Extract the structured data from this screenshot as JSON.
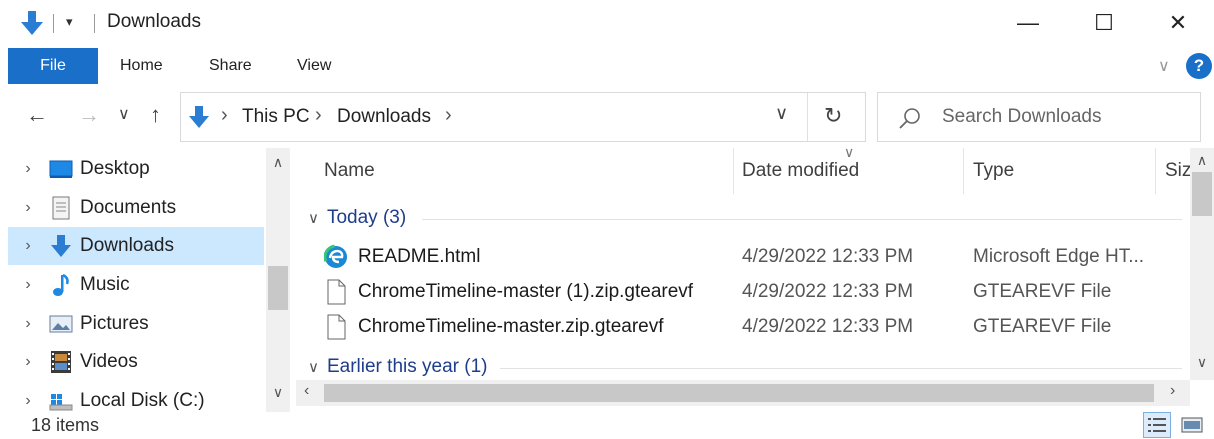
{
  "window": {
    "title": "Downloads",
    "minimize_glyph": "—",
    "maximize_glyph": "☐",
    "close_glyph": "✕"
  },
  "quick_access": {
    "dropdown_glyph": "▾"
  },
  "ribbon": {
    "tabs": [
      "File",
      "Home",
      "Share",
      "View"
    ],
    "expand_glyph": "∨",
    "help_glyph": "?"
  },
  "nav": {
    "back_glyph": "←",
    "forward_glyph": "→",
    "recent_glyph": "∨",
    "up_glyph": "↑",
    "refresh_glyph": "↻",
    "address_dropdown_glyph": "∨",
    "breadcrumb": [
      "This PC",
      "Downloads"
    ],
    "crumb_sep_glyph": "›"
  },
  "search": {
    "placeholder": "Search Downloads"
  },
  "tree": {
    "items": [
      {
        "label": "Desktop",
        "icon": "desktop-icon"
      },
      {
        "label": "Documents",
        "icon": "documents-icon"
      },
      {
        "label": "Downloads",
        "icon": "downloads-icon",
        "selected": true
      },
      {
        "label": "Music",
        "icon": "music-icon"
      },
      {
        "label": "Pictures",
        "icon": "pictures-icon"
      },
      {
        "label": "Videos",
        "icon": "videos-icon"
      },
      {
        "label": "Local Disk (C:)",
        "icon": "disk-icon"
      }
    ],
    "chevron_glyph": "›"
  },
  "columns": {
    "name": "Name",
    "date": "Date modified",
    "type": "Type",
    "size": "Siz"
  },
  "groups": [
    {
      "label": "Today (3)",
      "expanded": true
    },
    {
      "label": "Earlier this year (1)",
      "expanded": true
    }
  ],
  "files": [
    {
      "name": "README.html",
      "date": "4/29/2022 12:33 PM",
      "type": "Microsoft Edge HT...",
      "icon": "edge-icon"
    },
    {
      "name": "ChromeTimeline-master (1).zip.gtearevf",
      "date": "4/29/2022 12:33 PM",
      "type": "GTEAREVF File",
      "icon": "file-icon"
    },
    {
      "name": "ChromeTimeline-master.zip.gtearevf",
      "date": "4/29/2022 12:33 PM",
      "type": "GTEAREVF File",
      "icon": "file-icon"
    }
  ],
  "status": {
    "item_count": "18 items"
  },
  "colors": {
    "accent": "#1a6fc9",
    "selected_bg": "#cce8ff",
    "group_text": "#1e3d8a"
  }
}
